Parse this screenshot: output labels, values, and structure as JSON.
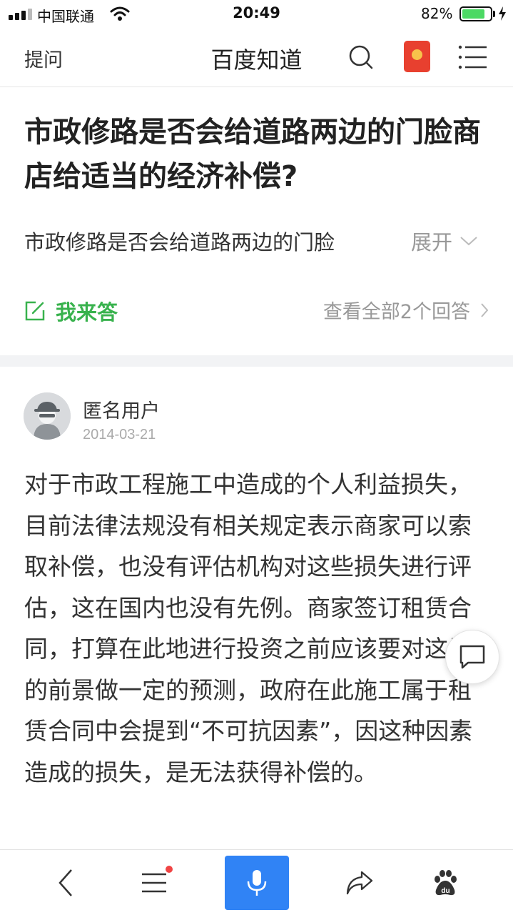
{
  "status_bar": {
    "carrier": "中国联通",
    "time": "20:49",
    "battery_percent": "82%",
    "battery_level": 0.82
  },
  "nav": {
    "ask_label": "提问",
    "title": "百度知道"
  },
  "question": {
    "title": "市政修路是否会给道路两边的门脸商店给适当的经济补偿?",
    "description": "市政修路是否会给道路两边的门脸",
    "expand_label": "展开",
    "answer_label": "我来答",
    "view_all_label": "查看全部2个回答"
  },
  "answer": {
    "author": "匿名用户",
    "date": "2014-03-21",
    "text": "对于市政工程施工中造成的个人利益损失，目前法律法规没有相关规定表示商家可以索取补偿，也没有评估机构对这些损失进行评估，这在国内也没有先例。商家签订租赁合同，打算在此地进行投资之前应该要对这里的前景做一定的预测，政府在此施工属于租赁合同中会提到“不可抗因素”，因这种因素造成的损失，是无法获得补偿的。"
  },
  "colors": {
    "accent_green": "#38b24d",
    "voice_blue": "#3083f5",
    "red_packet": "#e8402f",
    "battery_green": "#4cd964"
  },
  "icons": [
    "signal-icon",
    "wifi-icon",
    "battery-icon",
    "charging-icon",
    "search-icon",
    "red-packet-icon",
    "menu-icon",
    "chevron-down-icon",
    "edit-icon",
    "chevron-right-icon",
    "comment-icon",
    "back-icon",
    "list-icon",
    "microphone-icon",
    "share-icon",
    "baidu-paw-icon"
  ]
}
